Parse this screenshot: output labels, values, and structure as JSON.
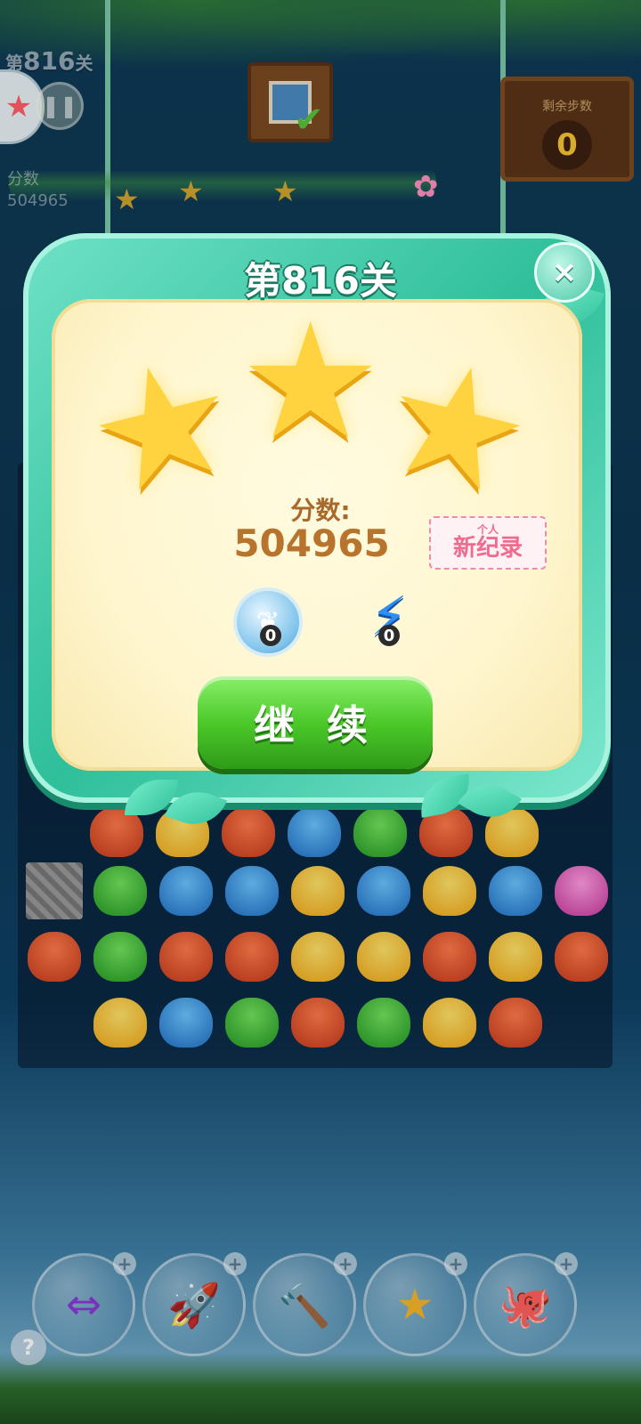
{
  "hud": {
    "level_prefix": "第",
    "level_number": "816",
    "level_suffix": "关",
    "score_label": "分数",
    "score_value": "504965",
    "moves_label": "剩余步数",
    "moves_value": "0"
  },
  "modal": {
    "title": "第816关",
    "stars_earned": 3,
    "stars_total": 3,
    "score_label": "分数:",
    "score_value": "504965",
    "record_small": "个人",
    "record_main": "新纪录",
    "reward_coin_count": "0",
    "reward_bolt_count": "0",
    "continue_label": "继 续",
    "close_label": "×"
  },
  "icons": {
    "close": "close-icon",
    "star": "star-icon",
    "coin": "leaf-coin-icon",
    "bolt": "lightning-icon",
    "pause": "pause-icon",
    "help": "help-icon"
  },
  "colors": {
    "frame": "#2fbf9a",
    "panel": "#fff6cf",
    "star": "#ffd23f",
    "continue_button": "#4cc92a",
    "score_text": "#b8742c",
    "record": "#f06b8f"
  },
  "boosters": [
    {
      "name": "swap-booster",
      "glyph": "⇔"
    },
    {
      "name": "rocket-booster",
      "glyph": "🚀"
    },
    {
      "name": "hammer-booster",
      "glyph": "🔨"
    },
    {
      "name": "star-wand-booster",
      "glyph": "★"
    },
    {
      "name": "octopus-booster",
      "glyph": "🐙"
    }
  ],
  "help_label": "?"
}
